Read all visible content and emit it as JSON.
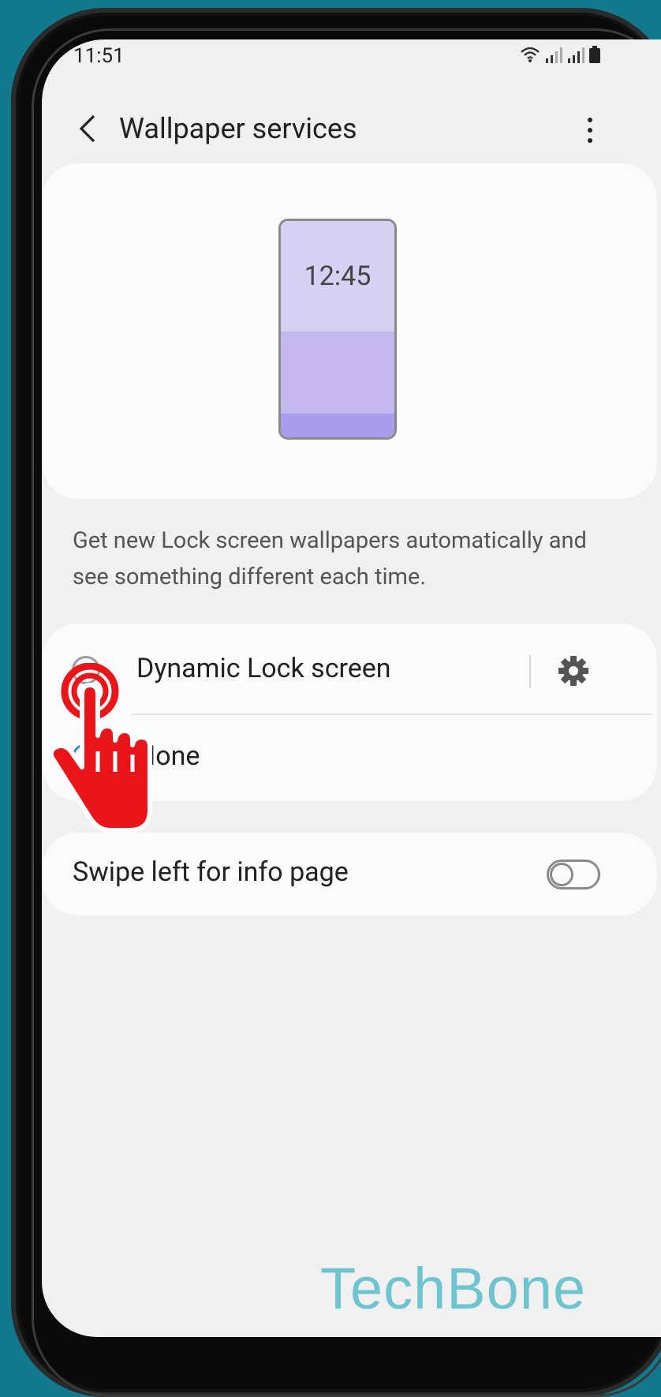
{
  "status_bar": {
    "time": "11:51",
    "icons": [
      "wifi-icon",
      "signal-icon",
      "signal-icon",
      "battery-icon"
    ]
  },
  "header": {
    "title": "Wallpaper services",
    "back_icon": "back-arrow-icon",
    "menu_icon": "more-vert-icon"
  },
  "preview": {
    "clock": "12:45"
  },
  "description": "Get new Lock screen wallpapers automatically and see something different each time.",
  "options": [
    {
      "label": "Dynamic Lock screen",
      "selected": false,
      "has_settings": true
    },
    {
      "label": "None",
      "selected": true
    }
  ],
  "swipe_setting": {
    "label": "Swipe left for info page",
    "enabled": false
  },
  "watermark": "TechBone",
  "colors": {
    "background": "#12788c",
    "accent": "#3d86d6",
    "tap_indicator": "#e8151b"
  }
}
